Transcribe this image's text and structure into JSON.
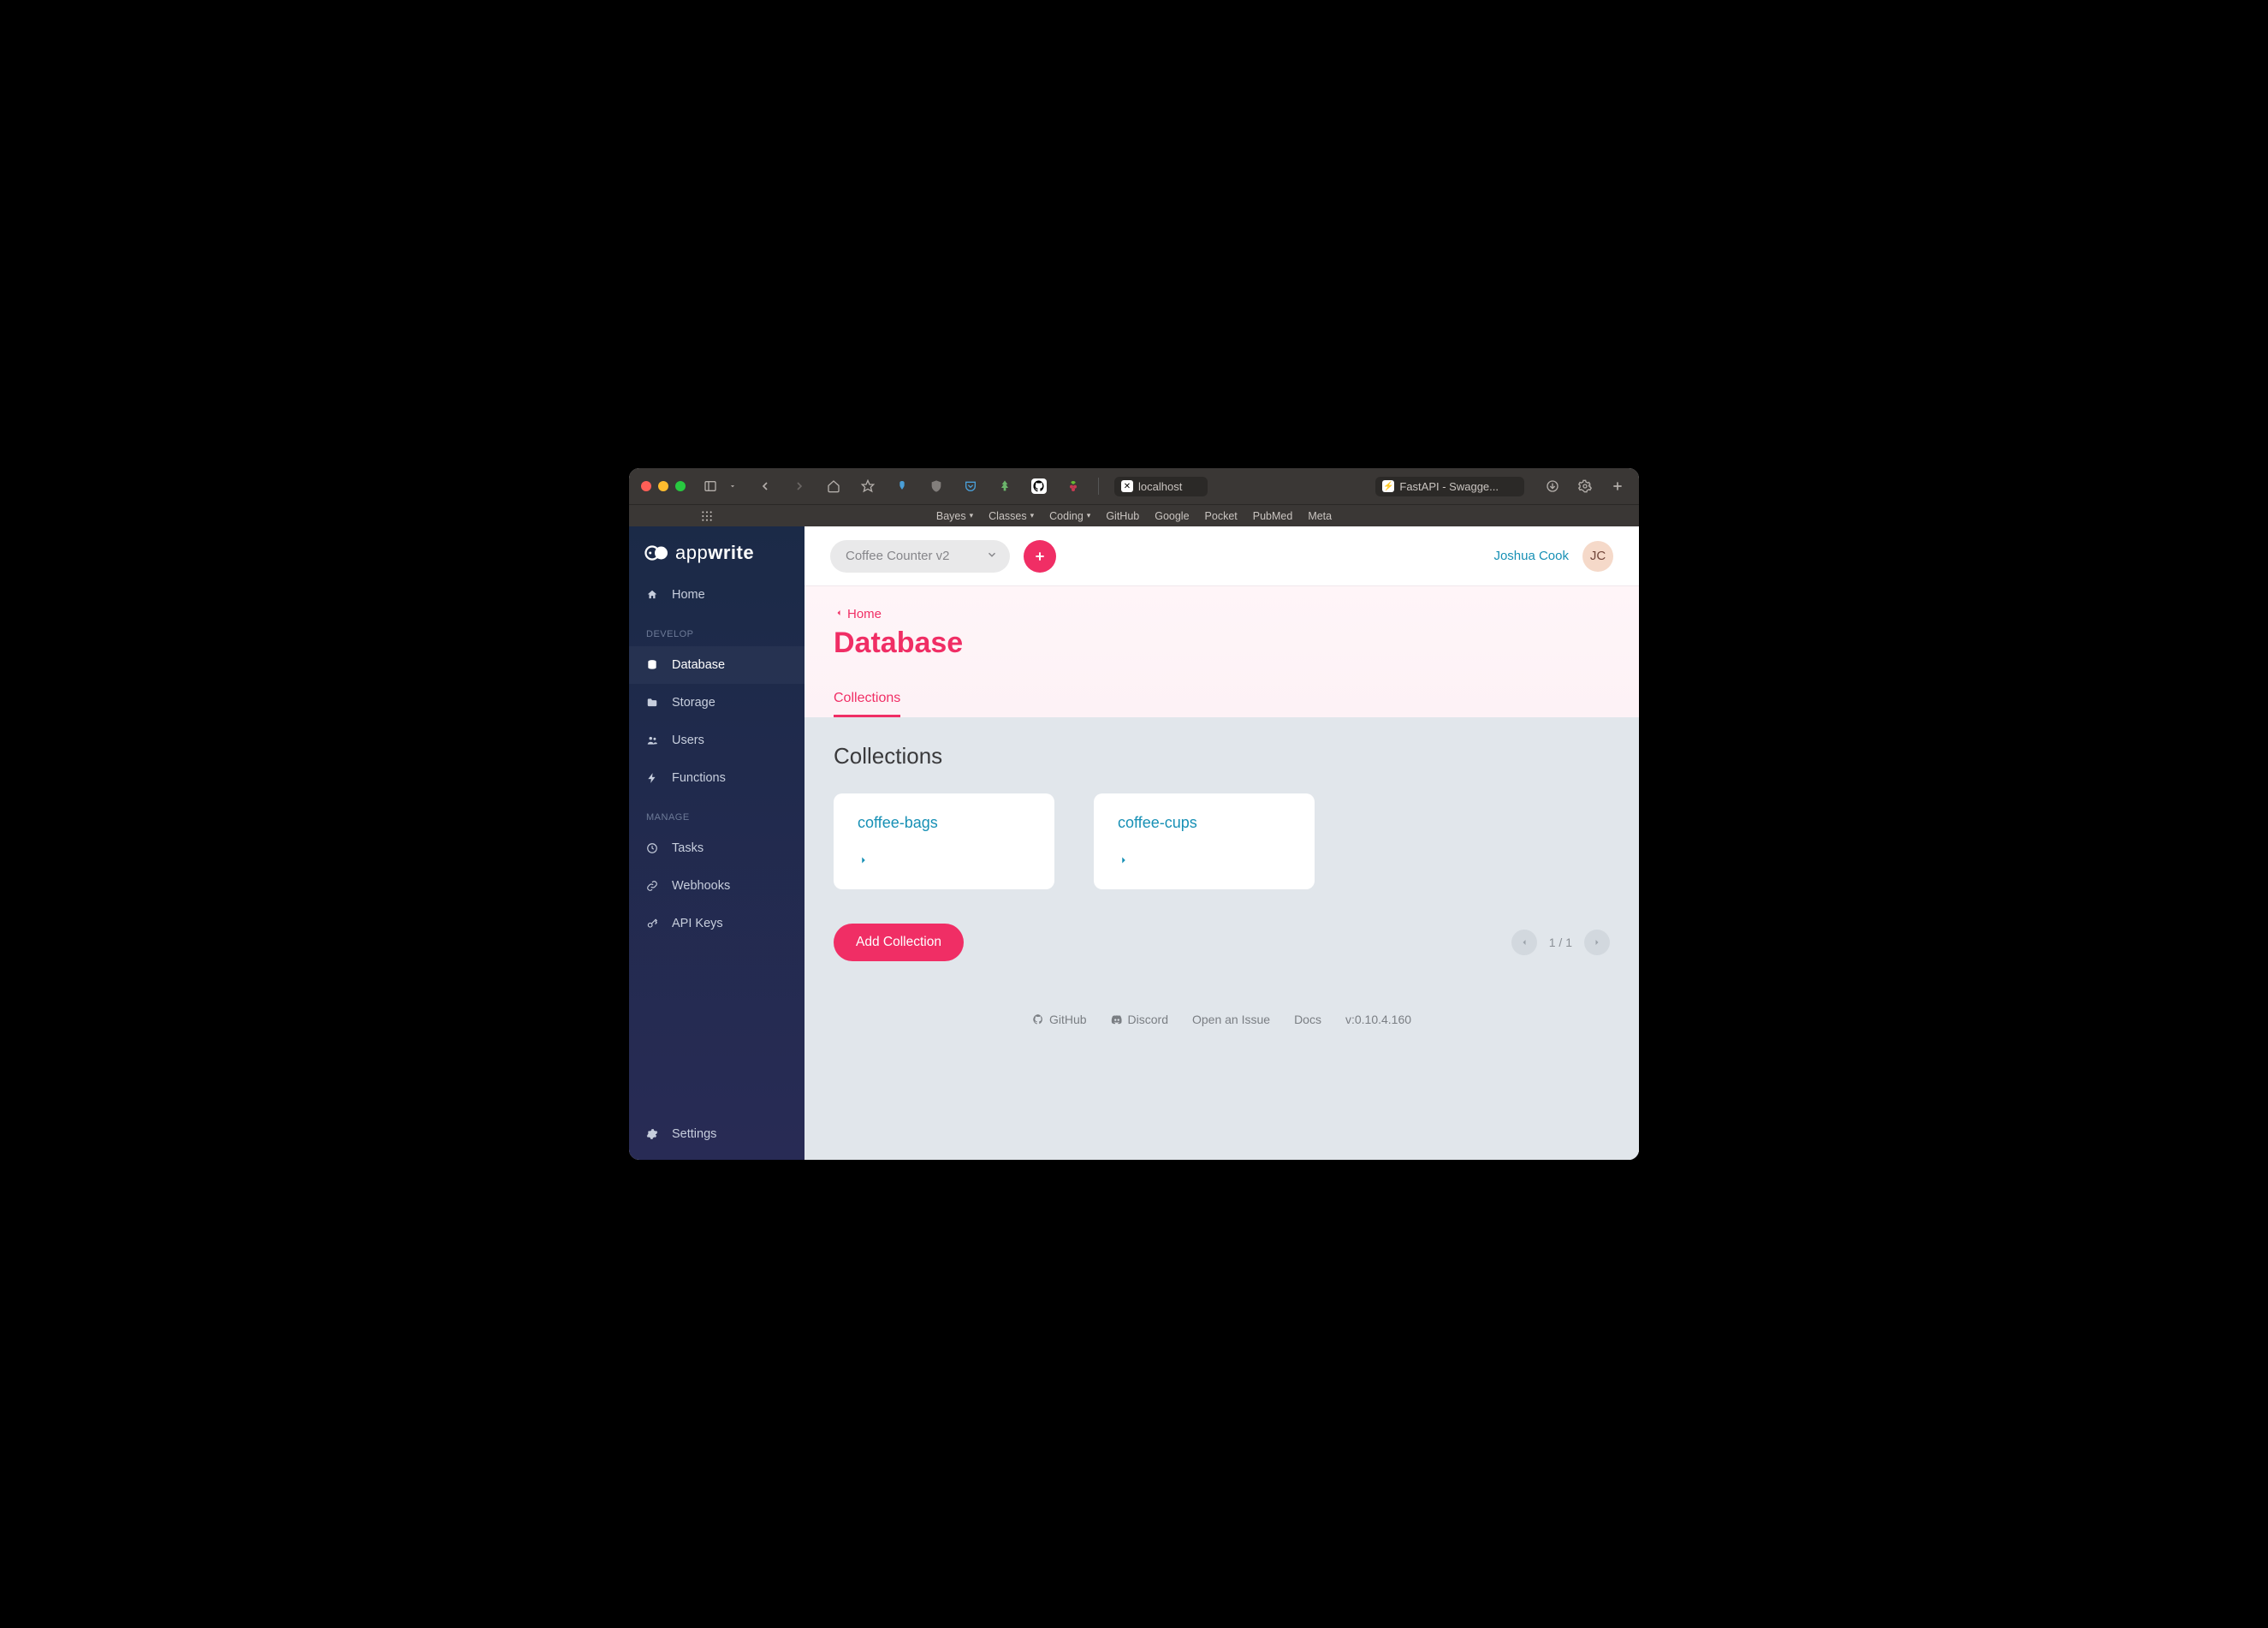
{
  "browser": {
    "tabs": [
      {
        "label": "localhost",
        "active": true
      },
      {
        "label": "FastAPI - Swagge..."
      }
    ],
    "bookmarks": [
      "Bayes",
      "Classes",
      "Coding",
      "GitHub",
      "Google",
      "Pocket",
      "PubMed",
      "Meta"
    ],
    "bookmark_has_dropdown": [
      true,
      true,
      true,
      false,
      false,
      false,
      false,
      false
    ]
  },
  "sidebar": {
    "logo_prefix": "app",
    "logo_suffix": "write",
    "items": [
      {
        "label": "Home",
        "icon": "home"
      }
    ],
    "develop_label": "DEVELOP",
    "develop": [
      {
        "label": "Database",
        "icon": "database",
        "active": true
      },
      {
        "label": "Storage",
        "icon": "folder"
      },
      {
        "label": "Users",
        "icon": "users"
      },
      {
        "label": "Functions",
        "icon": "bolt"
      }
    ],
    "manage_label": "MANAGE",
    "manage": [
      {
        "label": "Tasks",
        "icon": "clock"
      },
      {
        "label": "Webhooks",
        "icon": "link"
      },
      {
        "label": "API Keys",
        "icon": "key"
      }
    ],
    "settings_label": "Settings"
  },
  "topbar": {
    "project_name": "Coffee Counter v2",
    "user_name": "Joshua Cook",
    "user_initials": "JC"
  },
  "page": {
    "breadcrumb": "Home",
    "title": "Database",
    "tab": "Collections",
    "section_title": "Collections",
    "collections": [
      {
        "name": "coffee-bags"
      },
      {
        "name": "coffee-cups"
      }
    ],
    "add_button": "Add Collection",
    "pager": "1 / 1"
  },
  "footer": {
    "github": "GitHub",
    "discord": "Discord",
    "issue": "Open an Issue",
    "docs": "Docs",
    "version": "v:0.10.4.160"
  }
}
